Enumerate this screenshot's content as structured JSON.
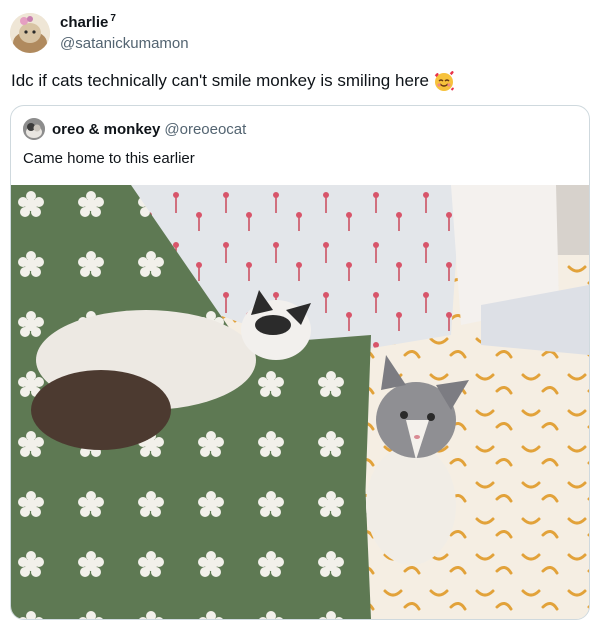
{
  "author": {
    "display_name": "charlie",
    "badge": "7",
    "handle": "@satanickumamon"
  },
  "tweet": {
    "text": "Idc if cats technically can't smile monkey is smiling here",
    "emoji": "smiling-face-with-hearts-icon"
  },
  "quote": {
    "display_name": "oreo & monkey",
    "handle": "@oreoeocat",
    "text": "Came home to this earlier",
    "media": "photo of two cats lying on a bed with a green flower blanket"
  },
  "colors": {
    "text_primary": "#0f1419",
    "text_secondary": "#536471",
    "border": "#cfd9de",
    "blanket_green": "#5f7a55",
    "sheet_cream": "#f3ece1"
  }
}
